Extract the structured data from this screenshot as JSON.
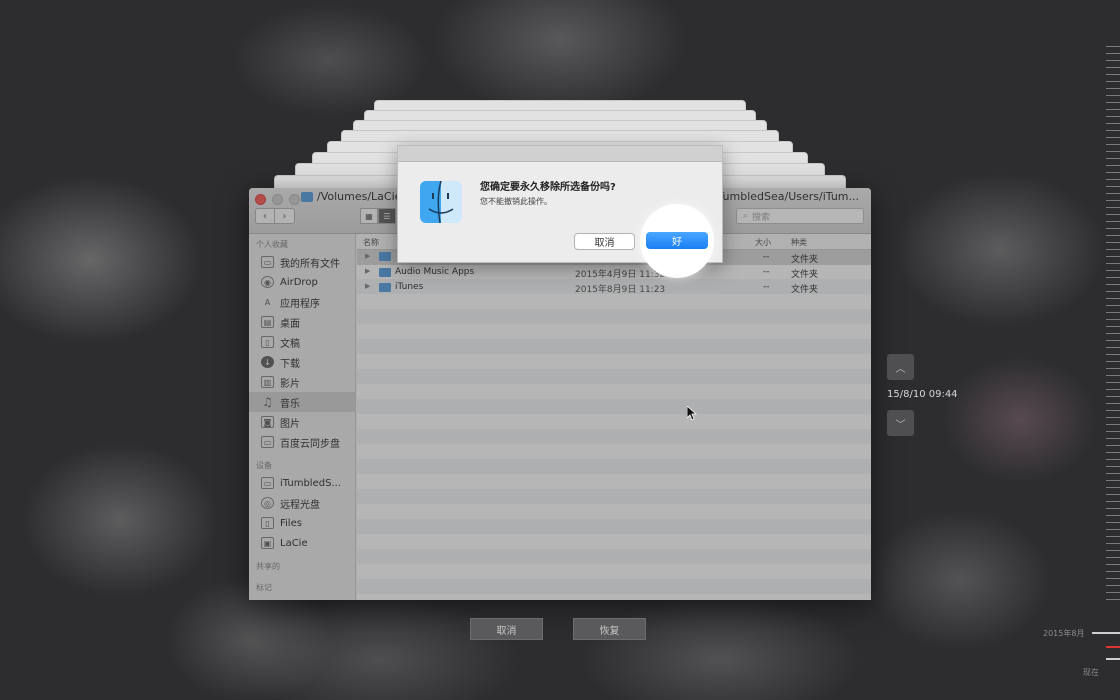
{
  "finder": {
    "path_left": "/Volumes/LaCie/",
    "path_right": "/iTumbledSea/Users/iTum...",
    "search_placeholder": "搜索",
    "sidebar": {
      "favorites_header": "个人收藏",
      "favorites": [
        {
          "label": "我的所有文件",
          "icon": "all-files-icon"
        },
        {
          "label": "AirDrop",
          "icon": "airdrop-icon"
        },
        {
          "label": "应用程序",
          "icon": "applications-icon"
        },
        {
          "label": "桌面",
          "icon": "desktop-icon"
        },
        {
          "label": "文稿",
          "icon": "documents-icon"
        },
        {
          "label": "下载",
          "icon": "downloads-icon"
        },
        {
          "label": "影片",
          "icon": "movies-icon"
        },
        {
          "label": "音乐",
          "icon": "music-icon"
        },
        {
          "label": "图片",
          "icon": "pictures-icon"
        },
        {
          "label": "百度云同步盘",
          "icon": "folder-icon"
        }
      ],
      "devices_header": "设备",
      "devices": [
        {
          "label": "iTumbledS...",
          "icon": "laptop-icon"
        },
        {
          "label": "远程光盘",
          "icon": "disc-icon"
        },
        {
          "label": "Files",
          "icon": "drive-icon"
        },
        {
          "label": "LaCie",
          "icon": "drive-icon"
        }
      ],
      "shared_header": "共享的",
      "tags_header": "标记"
    },
    "columns": {
      "name": "名称",
      "size": "大小",
      "kind": "种类"
    },
    "rows": [
      {
        "name": "",
        "date": "",
        "size": "--",
        "kind": "文件夹"
      },
      {
        "name": "Audio Music Apps",
        "date": "2015年4月9日 11:32",
        "size": "--",
        "kind": "文件夹"
      },
      {
        "name": "iTunes",
        "date": "2015年8月9日 11:23",
        "size": "--",
        "kind": "文件夹"
      }
    ]
  },
  "dialog": {
    "title": "您确定要永久移除所选备份吗?",
    "message": "您不能撤销此操作。",
    "cancel_label": "取消",
    "ok_label": "好"
  },
  "time_machine": {
    "cancel_label": "取消",
    "restore_label": "恢复",
    "snapshot_date": "15/8/10 09:44",
    "timeline_month": "2015年8月",
    "timeline_now": "现在"
  },
  "colors": {
    "accent": "#1a7ff5",
    "close": "#fc605c",
    "folder": "#5aa1e3"
  }
}
